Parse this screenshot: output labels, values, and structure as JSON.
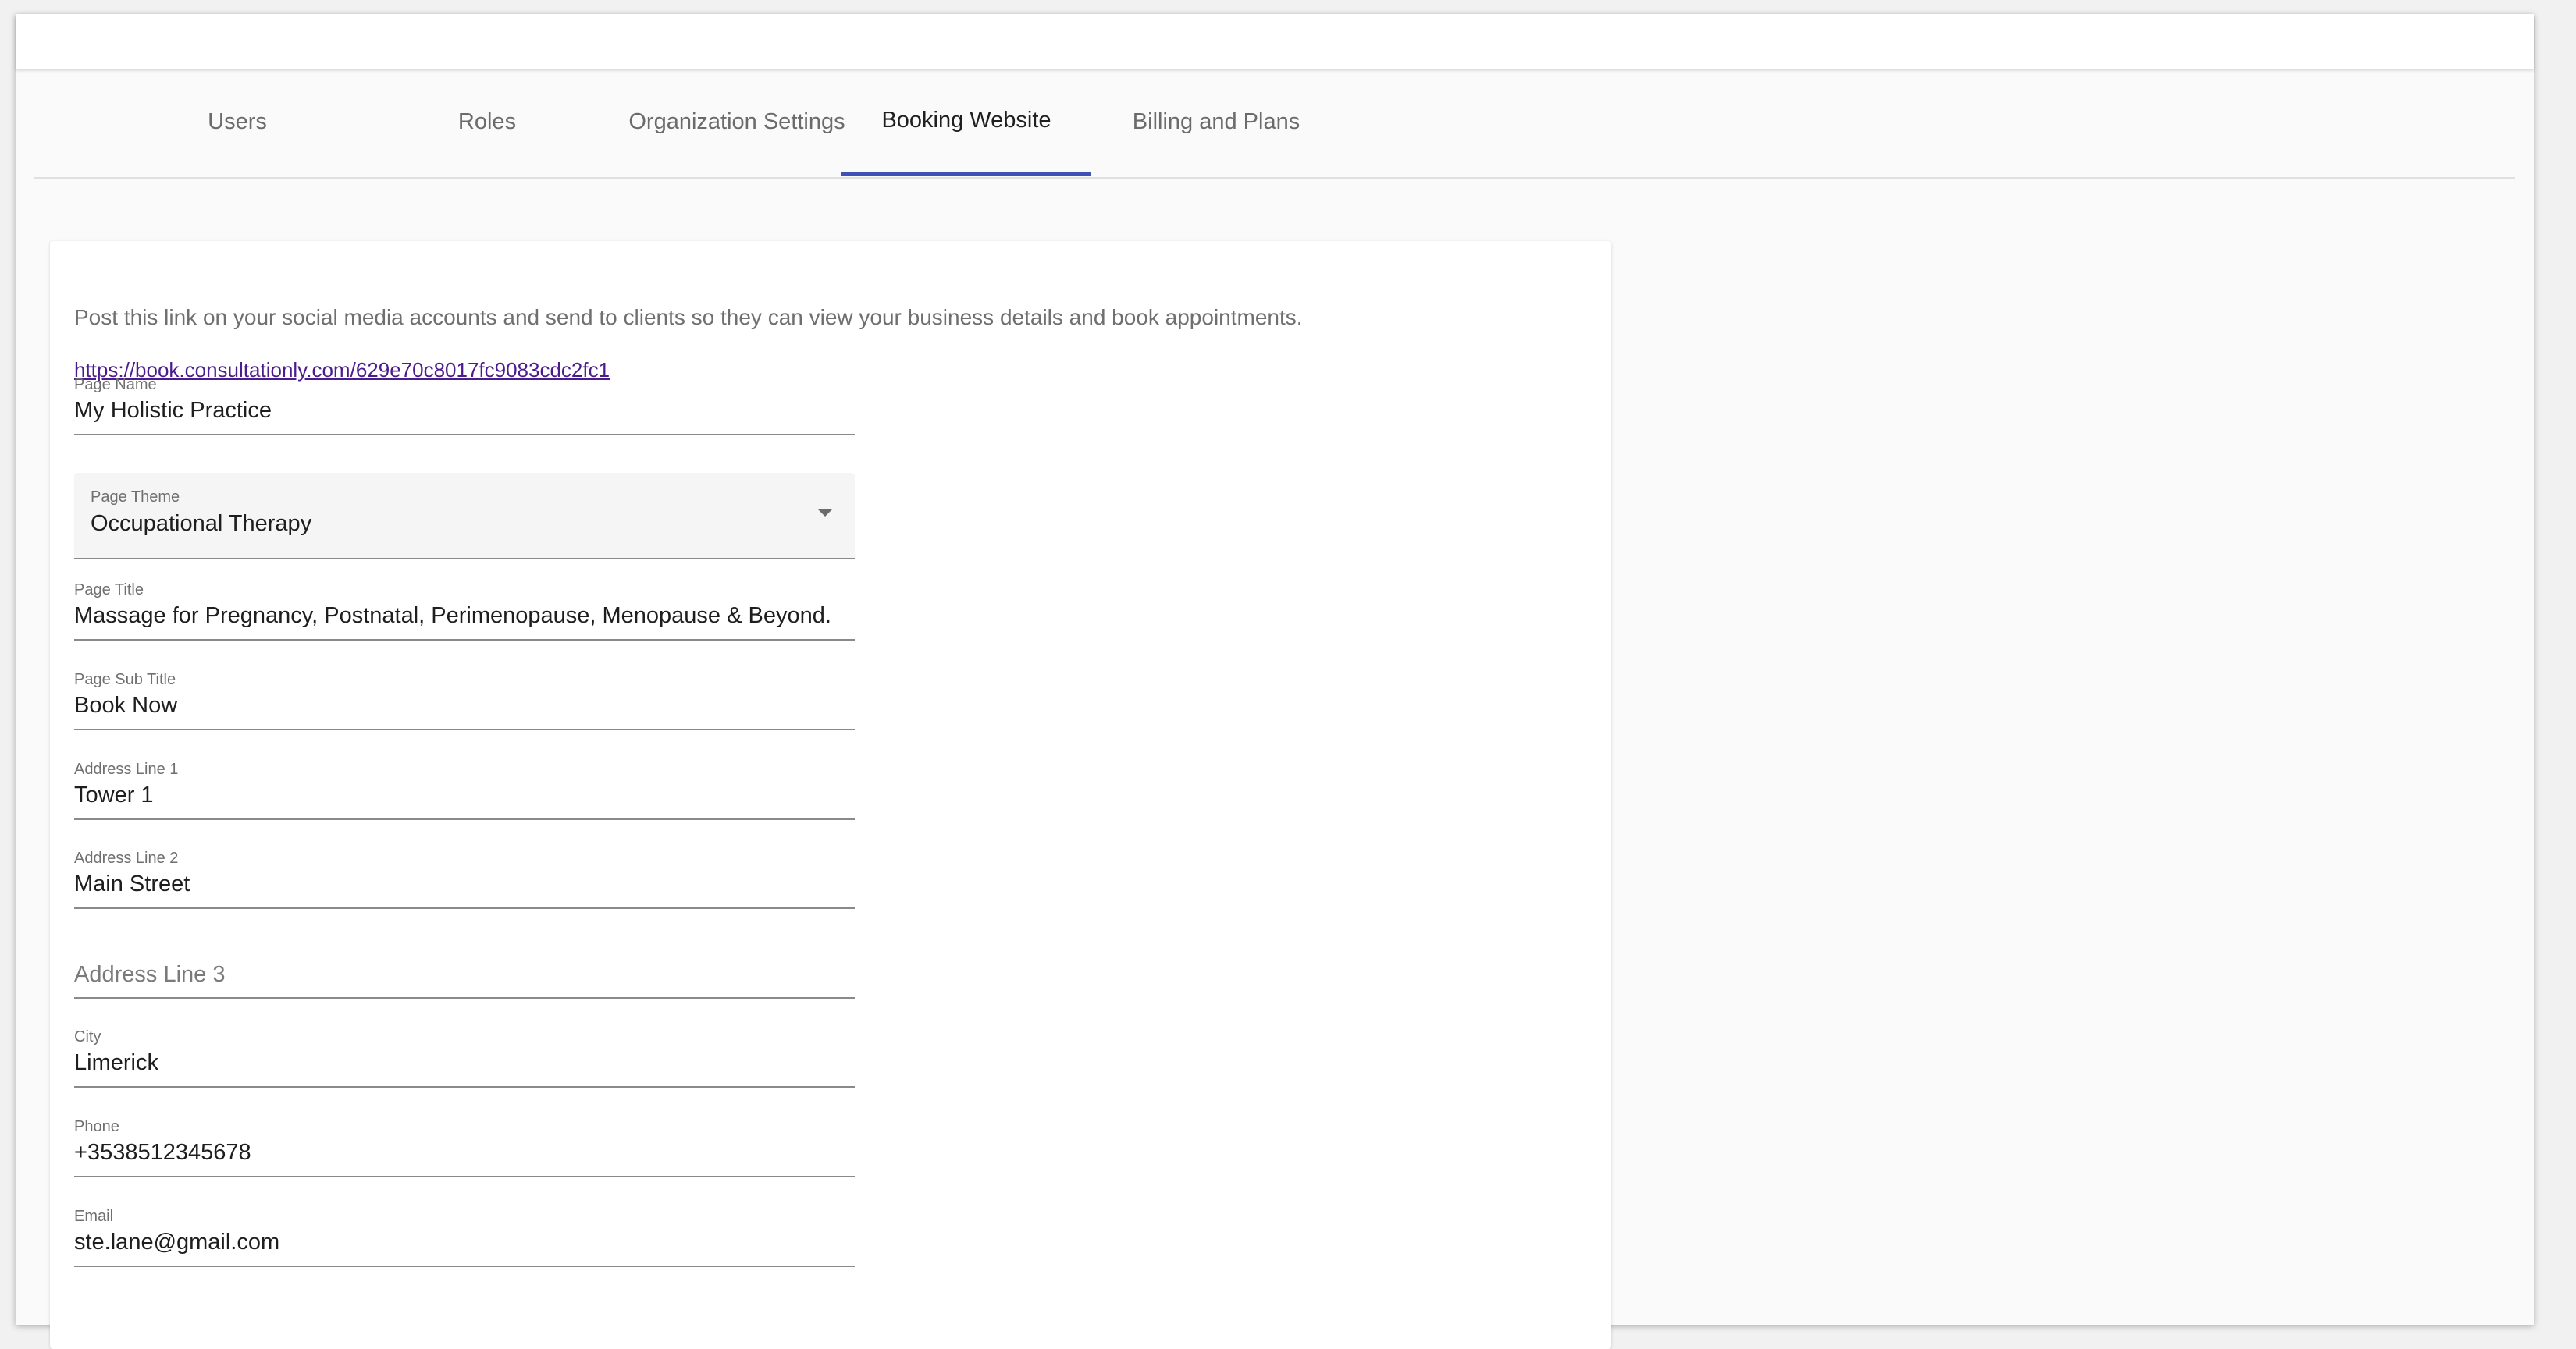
{
  "tabs": [
    {
      "label": "Users"
    },
    {
      "label": "Roles"
    },
    {
      "label": "Organization Settings"
    },
    {
      "label": "Booking Website",
      "active": true
    },
    {
      "label": "Billing and Plans"
    }
  ],
  "card": {
    "intro": "Post this link on your social media accounts and send to clients so they can view your business details and book appointments.",
    "link": "https://book.consultationly.com/629e70c8017fc9083cdc2fc1"
  },
  "form": {
    "page_name": {
      "label": "Page Name",
      "value": "My Holistic Practice"
    },
    "page_theme": {
      "label": "Page Theme",
      "value": "Occupational Therapy"
    },
    "page_title": {
      "label": "Page Title",
      "value": "Massage for Pregnancy, Postnatal, Perimenopause, Menopause & Beyond."
    },
    "page_sub_title": {
      "label": "Page Sub Title",
      "value": "Book Now"
    },
    "address_line_1": {
      "label": "Address Line 1",
      "value": "Tower 1"
    },
    "address_line_2": {
      "label": "Address Line 2",
      "value": "Main Street"
    },
    "address_line_3": {
      "placeholder": "Address Line 3",
      "value": ""
    },
    "city": {
      "label": "City",
      "value": "Limerick"
    },
    "phone": {
      "label": "Phone",
      "value": "+3538512345678"
    },
    "email": {
      "label": "Email",
      "value": "ste.lane@gmail.com"
    }
  },
  "colors": {
    "accent": "#3f51b5",
    "link": "#4b1c8e"
  },
  "icons": {
    "select_caret": "chevron-down-icon"
  }
}
